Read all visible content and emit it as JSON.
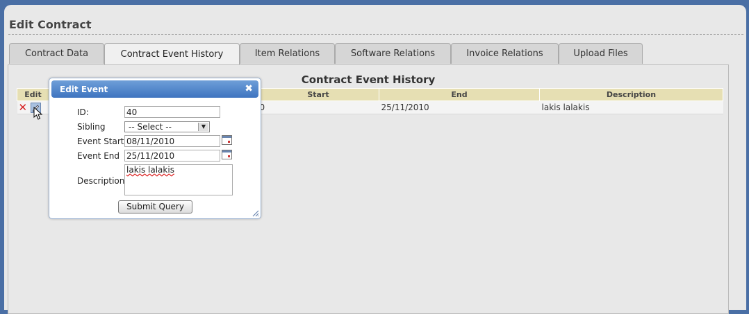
{
  "page": {
    "title": "Edit Contract"
  },
  "tabs": [
    {
      "label": "Contract Data",
      "active": false
    },
    {
      "label": "Contract Event History",
      "active": true
    },
    {
      "label": "Item Relations",
      "active": false
    },
    {
      "label": "Software Relations",
      "active": false
    },
    {
      "label": "Invoice Relations",
      "active": false
    },
    {
      "label": "Upload Files",
      "active": false
    }
  ],
  "history": {
    "title": "Contract Event History",
    "columns": [
      "Edit",
      "",
      "Start",
      "End",
      "Description"
    ],
    "rows": [
      {
        "start_visible": "0",
        "end": "25/11/2010",
        "description": "lakis lalakis"
      }
    ]
  },
  "dialog": {
    "title": "Edit Event",
    "fields": {
      "id_label": "ID:",
      "id_value": "40",
      "sibling_label": "Sibling",
      "sibling_value": "-- Select --",
      "start_label": "Event Start",
      "start_value": "08/11/2010",
      "end_label": "Event End",
      "end_value": "25/11/2010",
      "description_label": "Description",
      "description_value": "lakis lalakis"
    },
    "submit_label": "Submit Query"
  },
  "icons": {
    "close": "close-icon",
    "delete": "delete-icon",
    "edit": "pencil-icon",
    "calendar": "calendar-icon",
    "resize": "resize-grip-icon",
    "cursor": "mouse-pointer-icon"
  },
  "colors": {
    "header_bar": "#3e74c0",
    "table_header": "#e6dfb3",
    "background_frame": "#4a6fa5"
  }
}
